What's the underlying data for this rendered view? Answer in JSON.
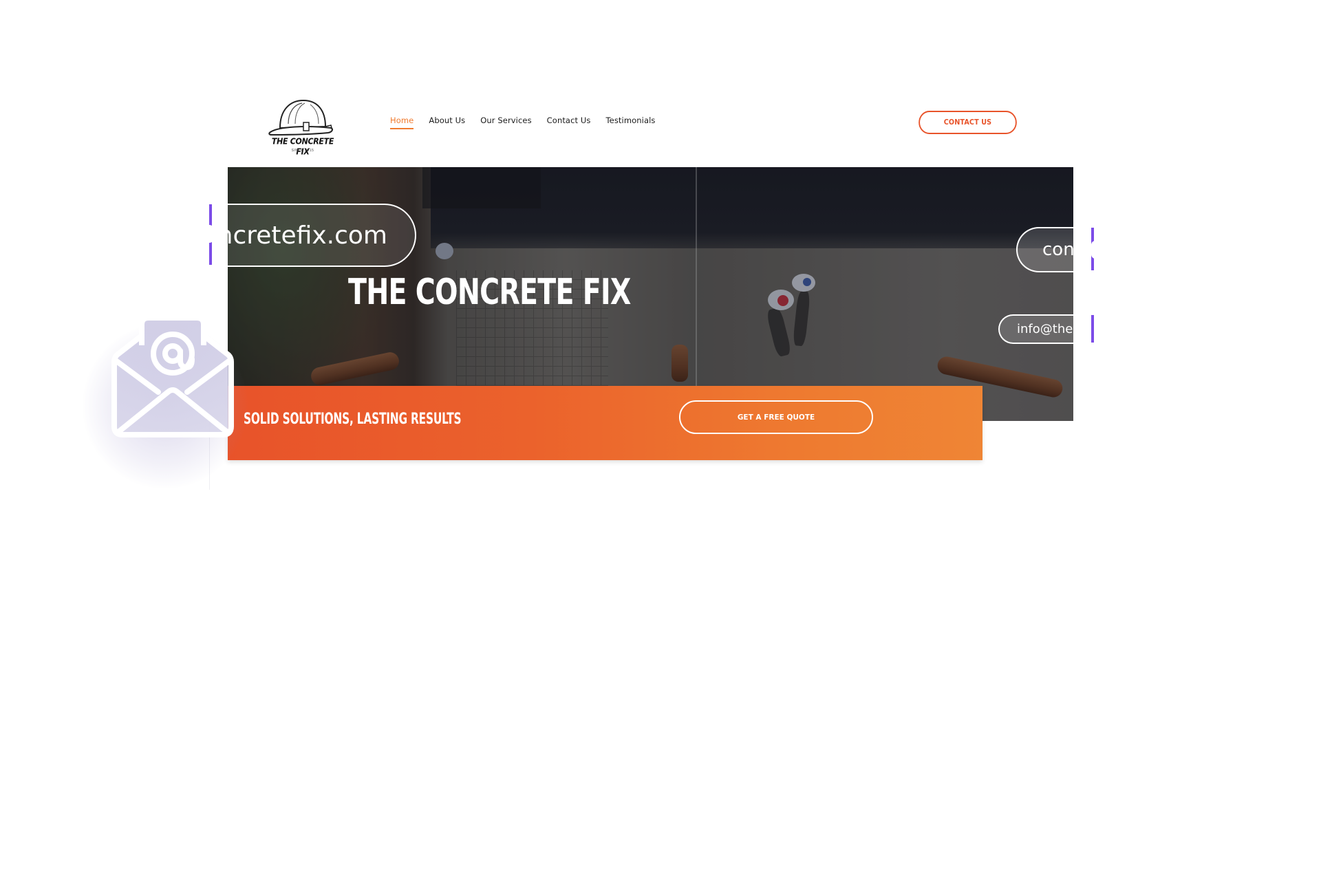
{
  "header": {
    "logo": {
      "name": "THE CONCRETE FIX",
      "since": "SINCE 2015",
      "icon": "hard-hat-icon"
    },
    "nav": [
      {
        "label": "Home",
        "active": true
      },
      {
        "label": "About Us",
        "active": false
      },
      {
        "label": "Our Services",
        "active": false
      },
      {
        "label": "Contact Us",
        "active": false
      },
      {
        "label": "Testimonials",
        "active": false
      }
    ],
    "cta_label": "CONTACT US"
  },
  "hero": {
    "title": "THE CONCRETE FIX",
    "tagline": "SOLID SOLUTIONS, LASTING RESULTS",
    "quote_button": "GET A FREE QUOTE"
  },
  "overlays": {
    "url_pill_text": "ncretefix.com",
    "contact_pill_text": "cont",
    "email_pill_text": "info@thec",
    "envelope_icon": "envelope-at-icon"
  },
  "colors": {
    "accent_orange": "#e8532a",
    "accent_orange_light": "#ef8535",
    "nav_active": "#f07a2e",
    "marker_purple": "#7c4ce8"
  }
}
